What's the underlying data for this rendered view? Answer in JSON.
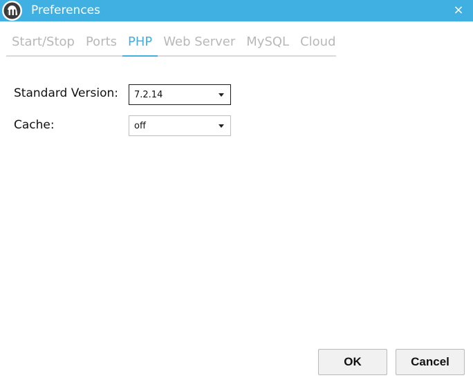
{
  "window": {
    "title": "Preferences",
    "close_symbol": "×",
    "app_icon": "mamp-elephant-logo-icon"
  },
  "tabs": [
    {
      "label": "Start/Stop",
      "active": false
    },
    {
      "label": "Ports",
      "active": false
    },
    {
      "label": "PHP",
      "active": true
    },
    {
      "label": "Web Server",
      "active": false
    },
    {
      "label": "MySQL",
      "active": false
    },
    {
      "label": "Cloud",
      "active": false
    }
  ],
  "php": {
    "standard_version": {
      "label": "Standard Version:",
      "value": "7.2.14"
    },
    "cache": {
      "label": "Cache:",
      "value": "off"
    }
  },
  "buttons": {
    "ok_label": "OK",
    "cancel_label": "Cancel"
  },
  "colors": {
    "accent": "#3fb0e1",
    "tab_inactive": "#b8b8b8"
  }
}
